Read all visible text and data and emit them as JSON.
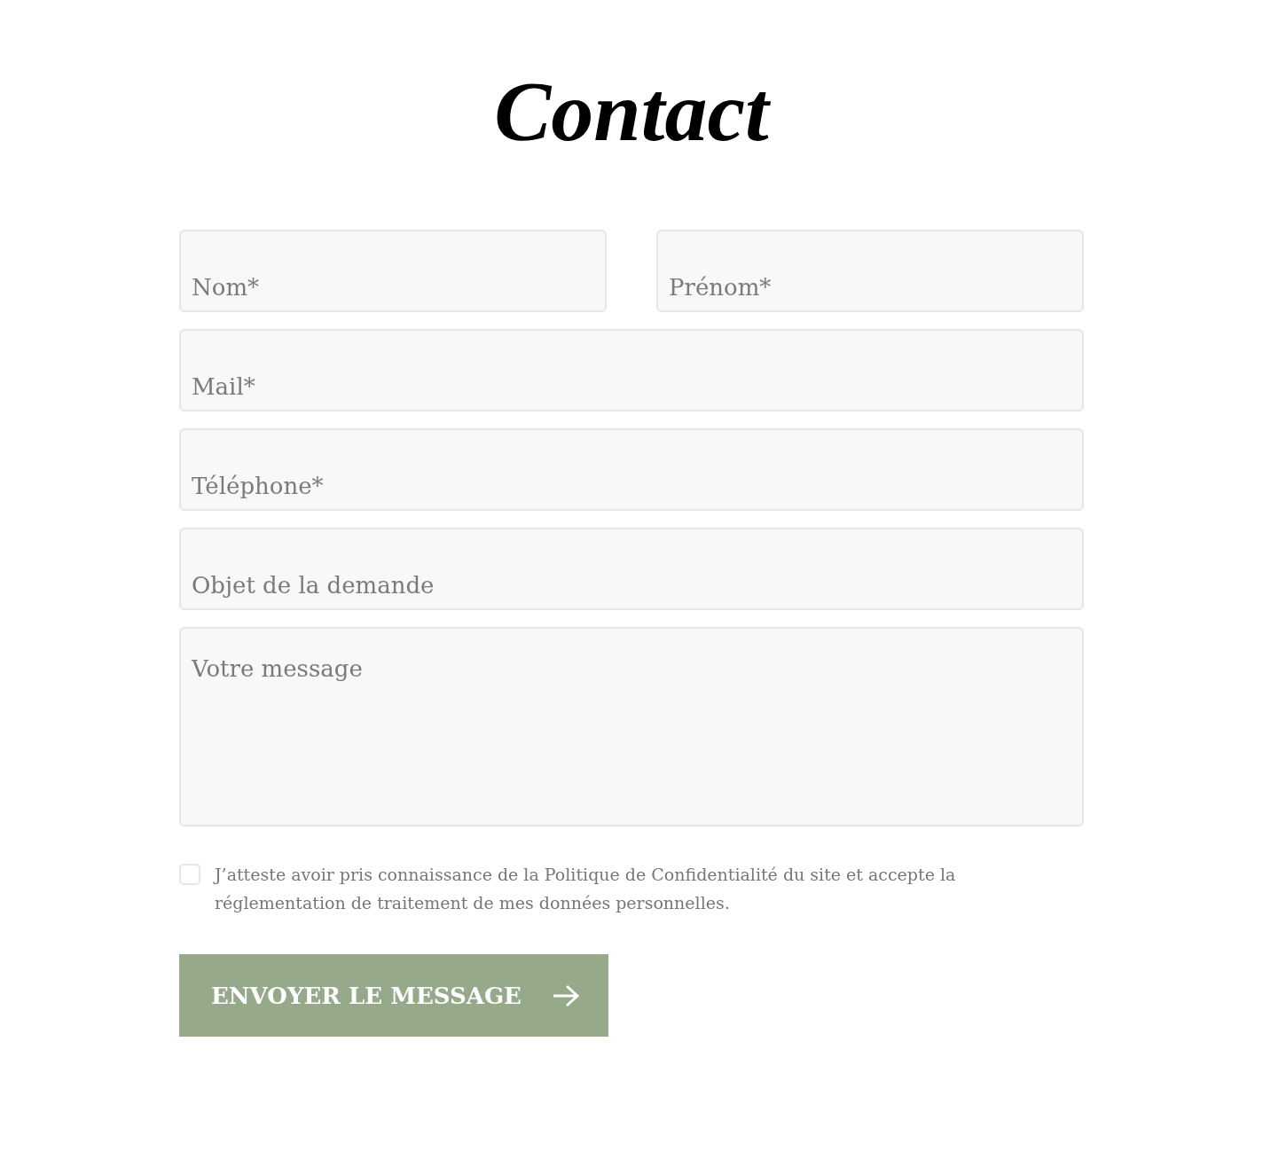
{
  "title": "Contact",
  "fields": [
    {
      "kind": "half",
      "placeholder": "Nom*"
    },
    {
      "kind": "half",
      "placeholder": "Prénom*"
    },
    {
      "kind": "full",
      "placeholder": "Mail*"
    },
    {
      "kind": "full",
      "placeholder": "Téléphone*"
    },
    {
      "kind": "full",
      "placeholder": "Objet de la demande"
    },
    {
      "kind": "textarea",
      "placeholder": "Votre message"
    }
  ],
  "consent": {
    "checked": false,
    "text": "J’atteste avoir pris connaissance de la Politique de Confidentialité du site et accepte la réglementation de traitement de mes données personnelles."
  },
  "submit": {
    "label": "ENVOYER LE MESSAGE"
  }
}
